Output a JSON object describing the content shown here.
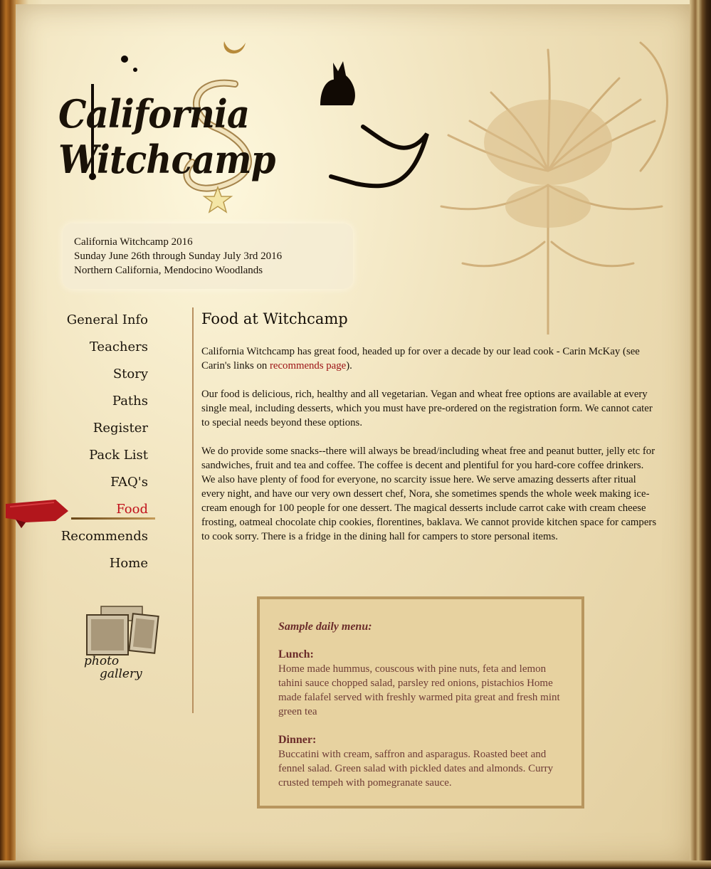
{
  "logo": {
    "text": "California Witchcamp"
  },
  "event_info": {
    "line1": "California Witchcamp 2016",
    "line2": "Sunday June 26th through Sunday July 3rd 2016",
    "line3": "Northern California, Mendocino Woodlands"
  },
  "nav": {
    "items": [
      {
        "label": "General Info"
      },
      {
        "label": "Teachers"
      },
      {
        "label": "Story"
      },
      {
        "label": "Paths"
      },
      {
        "label": "Register"
      },
      {
        "label": "Pack List"
      },
      {
        "label": "FAQ's"
      },
      {
        "label": "Food",
        "active": true
      },
      {
        "label": "Recommends"
      },
      {
        "label": "Home"
      }
    ]
  },
  "photo_gallery": {
    "label_line1": "photo",
    "label_line2": "gallery"
  },
  "main": {
    "title": "Food at Witchcamp",
    "p1_before": "California Witchcamp has great food, headed up for over a decade by our lead cook - Carin McKay (see Carin's links on ",
    "p1_link": "recommends page",
    "p1_after": ").",
    "p2": "Our food is delicious, rich, healthy and all vegetarian. Vegan and wheat free options are available at every single meal, including desserts, which you must have pre-ordered on the registration form. We cannot cater to special needs beyond these options.",
    "p3": "We do provide some snacks--there will always be bread/including wheat free and peanut butter, jelly etc for sandwiches, fruit and tea and coffee. The coffee is decent and plentiful for you hard-core coffee drinkers. We also have plenty of food for everyone, no scarcity issue here. We serve amazing desserts after ritual every night, and have our very own dessert chef, Nora, she sometimes spends the whole week making ice-cream enough for 100 people for one dessert. The magical desserts include carrot cake with cream cheese frosting, oatmeal chocolate chip cookies, florentines, baklava. We cannot provide kitchen space for campers to cook sorry. There is a fridge in the dining hall for campers to store personal items."
  },
  "menu": {
    "heading": "Sample daily menu:",
    "lunch_title": "Lunch:",
    "lunch_text": "Home made hummus, couscous with pine nuts, feta and lemon tahini sauce chopped salad, parsley red onions, pistachios Home made falafel served with freshly warmed pita great and fresh mint green tea",
    "dinner_title": "Dinner:",
    "dinner_text": "Buccatini with cream, saffron and asparagus. Roasted beet and fennel salad. Green salad with pickled dates and almonds. Curry crusted tempeh with pomegranate sauce."
  },
  "colors": {
    "link": "#9a0f12",
    "active_nav": "#c1121c",
    "menu_bg": "#e7d2a0",
    "menu_border": "#b8965e",
    "menu_text": "#6e3c36"
  }
}
